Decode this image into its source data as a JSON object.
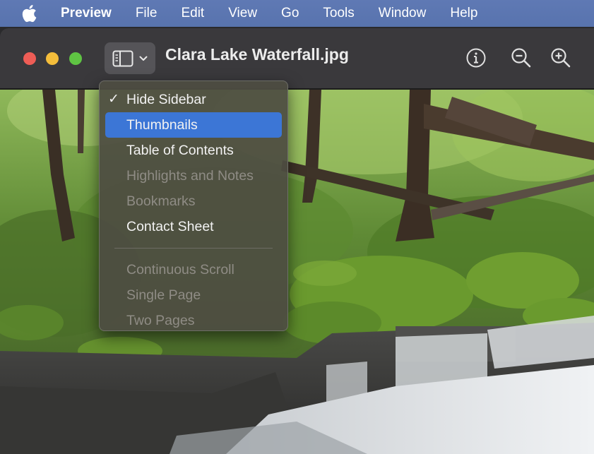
{
  "menubar": {
    "apple_icon": "apple-logo-icon",
    "items": [
      "Preview",
      "File",
      "Edit",
      "View",
      "Go",
      "Tools",
      "Window",
      "Help"
    ]
  },
  "window": {
    "title": "Clara Lake Waterfall.jpg",
    "traffic_colors": {
      "close": "#ee5d56",
      "minimize": "#f4bd3b",
      "maximize": "#5fc443"
    },
    "toolbar": {
      "sidebar_icon": "sidebar-icon",
      "chevron_icon": "chevron-down-icon",
      "info_icon": "info-icon",
      "zoom_out_icon": "zoom-out-icon",
      "zoom_in_icon": "zoom-in-icon"
    }
  },
  "dropdown": {
    "check_mark": "✓",
    "group1": [
      {
        "label": "Hide Sidebar",
        "checked": true,
        "selected": false,
        "disabled": false
      },
      {
        "label": "Thumbnails",
        "checked": false,
        "selected": true,
        "disabled": false
      },
      {
        "label": "Table of Contents",
        "checked": false,
        "selected": false,
        "disabled": false
      },
      {
        "label": "Highlights and Notes",
        "checked": false,
        "selected": false,
        "disabled": true
      },
      {
        "label": "Bookmarks",
        "checked": false,
        "selected": false,
        "disabled": true
      },
      {
        "label": "Contact Sheet",
        "checked": false,
        "selected": false,
        "disabled": false
      }
    ],
    "group2": [
      {
        "label": "Continuous Scroll",
        "disabled": true
      },
      {
        "label": "Single Page",
        "disabled": true
      },
      {
        "label": "Two Pages",
        "disabled": true
      }
    ],
    "selection_color": "#3c76d6"
  }
}
